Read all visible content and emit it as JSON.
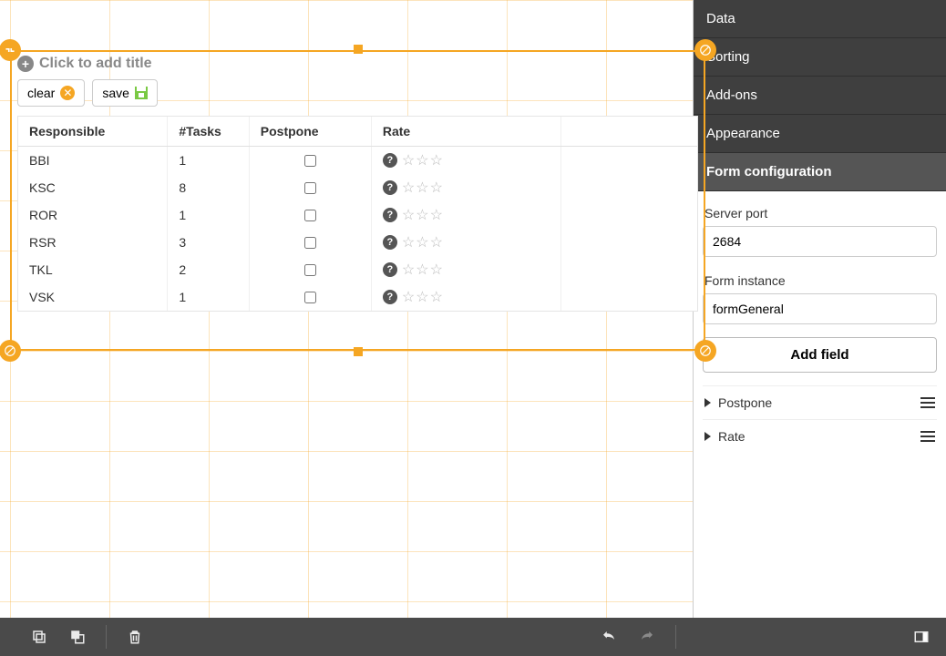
{
  "widget": {
    "titlePlaceholder": "Click to add title",
    "buttons": {
      "clear": "clear",
      "save": "save"
    },
    "columns": {
      "responsible": "Responsible",
      "tasks": "#Tasks",
      "postpone": "Postpone",
      "rate": "Rate"
    },
    "rows": [
      {
        "responsible": "BBI",
        "tasks": "1",
        "postpone": false,
        "rate": 0
      },
      {
        "responsible": "KSC",
        "tasks": "8",
        "postpone": false,
        "rate": 0
      },
      {
        "responsible": "ROR",
        "tasks": "1",
        "postpone": false,
        "rate": 0
      },
      {
        "responsible": "RSR",
        "tasks": "3",
        "postpone": false,
        "rate": 0
      },
      {
        "responsible": "TKL",
        "tasks": "2",
        "postpone": false,
        "rate": 0
      },
      {
        "responsible": "VSK",
        "tasks": "1",
        "postpone": false,
        "rate": 0
      }
    ]
  },
  "sidebar": {
    "sections": {
      "data": "Data",
      "sorting": "Sorting",
      "addons": "Add-ons",
      "appearance": "Appearance",
      "formconfig": "Form configuration"
    },
    "form": {
      "serverPortLabel": "Server port",
      "serverPortValue": "2684",
      "formInstanceLabel": "Form instance",
      "formInstanceValue": "formGeneral",
      "addField": "Add field",
      "fields": [
        {
          "name": "Postpone"
        },
        {
          "name": "Rate"
        }
      ]
    }
  },
  "icons": {
    "plus": "plus-circle-icon",
    "cancel": "cancel-circle-icon",
    "save": "save-disk-icon",
    "question": "help-circle-icon",
    "star": "star-outline-icon",
    "resize": "resize-handle-icon",
    "copy": "copy-icon",
    "stackFront": "bring-front-icon",
    "stackBack": "send-back-icon",
    "trash": "trash-icon",
    "undo": "undo-icon",
    "redo": "redo-icon",
    "panelToggle": "panel-toggle-icon",
    "caretRight": "caret-right-icon",
    "dragHandle": "drag-handle-icon"
  }
}
